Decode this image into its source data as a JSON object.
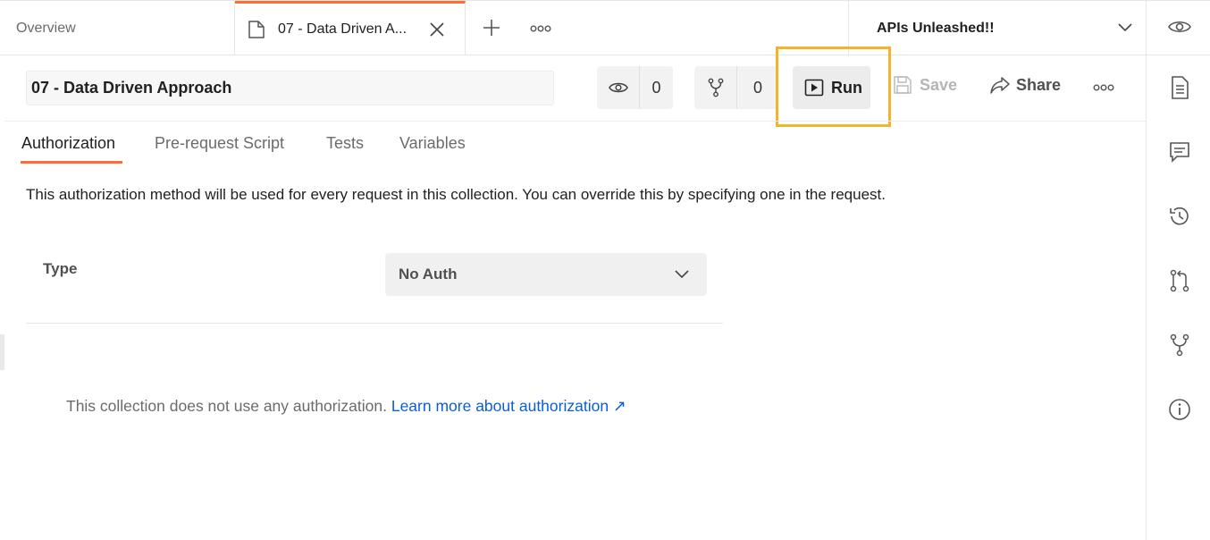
{
  "tabs": {
    "overview_label": "Overview",
    "active_label": "07 - Data Driven A..."
  },
  "workspace": {
    "name": "APIs Unleashed!!"
  },
  "collection": {
    "name": "07 - Data Driven Approach"
  },
  "toolbar": {
    "watch_count": "0",
    "fork_count": "0",
    "run_label": "Run",
    "save_label": "Save",
    "share_label": "Share"
  },
  "subtabs": [
    {
      "label": "Authorization",
      "active": true
    },
    {
      "label": "Pre-request Script",
      "active": false
    },
    {
      "label": "Tests",
      "active": false
    },
    {
      "label": "Variables",
      "active": false
    }
  ],
  "authorization": {
    "description": "This authorization method will be used for every request in this collection. You can override this by specifying one in the request.",
    "type_label": "Type",
    "type_value": "No Auth",
    "info_text": "This collection does not use any authorization.",
    "learn_more": "Learn more about authorization ↗"
  },
  "right_sidebar_icons": [
    "eye-icon",
    "documentation-icon",
    "comments-icon",
    "history-icon",
    "pull-request-icon",
    "fork-icon",
    "info-icon"
  ],
  "colors": {
    "accent": "#ff6c37",
    "highlight": "#f0b52a",
    "link": "#0b5fd1"
  }
}
